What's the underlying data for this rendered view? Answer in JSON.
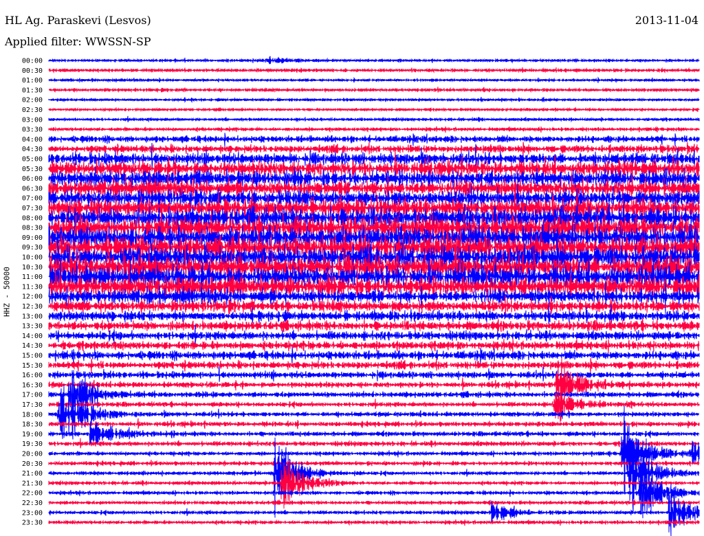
{
  "header": {
    "station": "HL Ag. Paraskevi (Lesvos)",
    "date": "2013-11-04",
    "filter": "Applied filter: WWSSN-SP"
  },
  "chart_data": {
    "type": "line",
    "title": "HL Ag. Paraskevi (Lesvos)",
    "ylabel": "HHZ - 50000",
    "xlabel": "",
    "row_minutes": 30,
    "colors": [
      "#0000ff",
      "#ff0040"
    ],
    "row_labels": [
      "00:00",
      "00:30",
      "01:00",
      "01:30",
      "02:00",
      "02:30",
      "03:00",
      "03:30",
      "04:00",
      "04:30",
      "05:00",
      "05:30",
      "06:00",
      "06:30",
      "07:00",
      "07:30",
      "08:00",
      "08:30",
      "09:00",
      "09:30",
      "10:00",
      "10:30",
      "11:00",
      "11:30",
      "12:00",
      "12:30",
      "13:00",
      "13:30",
      "14:00",
      "14:30",
      "15:00",
      "15:30",
      "16:00",
      "16:30",
      "17:00",
      "17:30",
      "18:00",
      "18:30",
      "19:00",
      "19:30",
      "20:00",
      "20:30",
      "21:00",
      "21:30",
      "22:00",
      "22:30",
      "23:00",
      "23:30"
    ],
    "relative_amplitude": [
      0.05,
      0.08,
      0.05,
      0.08,
      0.05,
      0.05,
      0.07,
      0.1,
      0.25,
      0.3,
      0.5,
      0.65,
      0.7,
      0.7,
      0.7,
      0.8,
      0.9,
      1.0,
      1.0,
      1.0,
      1.0,
      1.0,
      0.95,
      0.9,
      0.6,
      0.5,
      0.4,
      0.4,
      0.35,
      0.35,
      0.35,
      0.3,
      0.25,
      0.2,
      0.2,
      0.15,
      0.15,
      0.15,
      0.15,
      0.15,
      0.12,
      0.12,
      0.1,
      0.1,
      0.1,
      0.1,
      0.1,
      0.1
    ],
    "events": [
      {
        "row": 0,
        "minute": 10,
        "amp": 0.3
      },
      {
        "row": 34,
        "minute": 1,
        "amp": 2.5
      },
      {
        "row": 36,
        "minute": 0.5,
        "amp": 3.5
      },
      {
        "row": 38,
        "minute": 2,
        "amp": 1.5
      },
      {
        "row": 33,
        "minute": 23.5,
        "amp": 2.2
      },
      {
        "row": 35,
        "minute": 23.4,
        "amp": 1.5
      },
      {
        "row": 42,
        "minute": 10.5,
        "amp": 3.0
      },
      {
        "row": 43,
        "minute": 10.8,
        "amp": 2.5
      },
      {
        "row": 40,
        "minute": 26.5,
        "amp": 3.5
      },
      {
        "row": 42,
        "minute": 26.8,
        "amp": 3.5
      },
      {
        "row": 44,
        "minute": 27.3,
        "amp": 2.5
      },
      {
        "row": 46,
        "minute": 28.7,
        "amp": 2.0
      },
      {
        "row": 40,
        "minute": 29.7,
        "amp": 2.0
      },
      {
        "row": 46,
        "minute": 20.5,
        "amp": 0.8
      }
    ]
  }
}
